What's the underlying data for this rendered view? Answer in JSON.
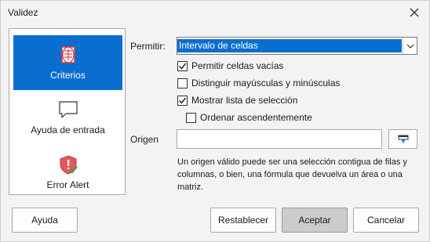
{
  "window": {
    "title": "Validez"
  },
  "tabs": [
    {
      "label": "Criterios",
      "icon": "criteria-list-icon",
      "selected": true
    },
    {
      "label": "Ayuda de entrada",
      "icon": "speech-bubble-icon",
      "selected": false
    },
    {
      "label": "Error Alert",
      "icon": "error-shield-icon",
      "selected": false
    }
  ],
  "criteria": {
    "allow_label": "Permitir:",
    "allow_value": "Intervalo de celdas",
    "allow_empty": {
      "label": "Permitir celdas vacías",
      "checked": true
    },
    "case_sensitive": {
      "label": "Distinguir mayúsculas y minúsculas",
      "checked": false
    },
    "show_list": {
      "label": "Mostrar lista de selección",
      "checked": true
    },
    "sort_ascending": {
      "label": "Ordenar ascendentemente",
      "checked": false
    },
    "source_label": "Origen",
    "source_value": "",
    "source_help": "Un origen válido puede ser una selección contigua de filas y columnas, o bien, una fórmula que devuelva un área o una matriz."
  },
  "buttons": {
    "help": "Ayuda",
    "reset": "Restablecer",
    "ok": "Aceptar",
    "cancel": "Cancelar"
  },
  "colors": {
    "accent": "#0a6ed1",
    "error": "#e05a5a",
    "check": "#2e9e3e"
  }
}
